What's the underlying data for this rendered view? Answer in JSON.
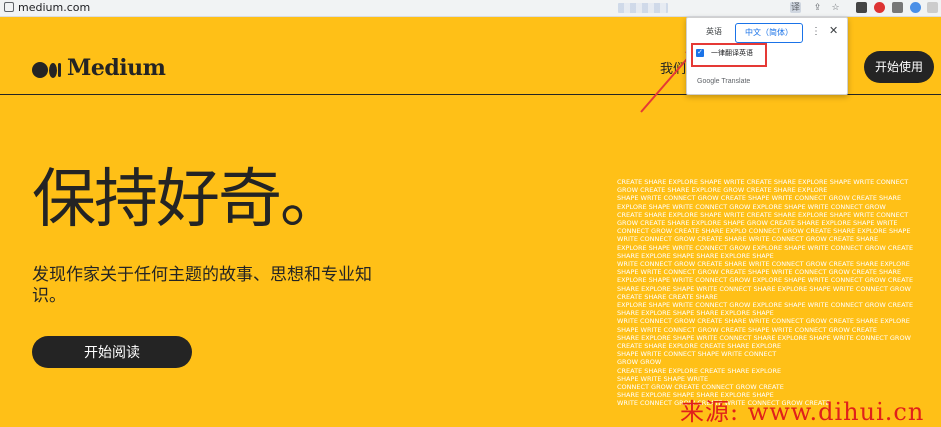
{
  "browser": {
    "url": "medium.com"
  },
  "header": {
    "logo_text": "Medium",
    "nav_partial": "我们",
    "start_button": "开始使用"
  },
  "hero": {
    "title": "保持好奇。",
    "subtitle": "发现作家关于任何主题的故事、思想和专业知识。",
    "read_button": "开始阅读"
  },
  "translate_popup": {
    "tab_source": "英语",
    "tab_target": "中文（简体）",
    "always_translate": "一律翻译英语",
    "always_checked": true,
    "footer_brand": "Google",
    "footer_product": "Translate"
  },
  "word_art": [
    "CREATE SHARE EXPLORE SHAPE WRITE  CREATE SHARE EXPLORE SHAPE WRITE CONNECT",
    "GROW CREATE SHARE EXPLORE         GROW CREATE SHARE EXPLORE",
    "SHAPE WRITE CONNECT GROW CREATE   SHAPE WRITE CONNECT GROW CREATE SHARE",
    "EXPLORE SHAPE WRITE CONNECT GROW  EXPLORE SHAPE WRITE CONNECT GROW",
    "CREATE SHARE EXPLORE SHAPE WRITE  CREATE SHARE EXPLORE SHAPE WRITE CONNECT",
    "GROW CREATE SHARE EXPLORE SHAPE   GROW CREATE SHARE EXPLORE SHAPE WRITE",
    "CONNECT GROW CREATE SHARE EXPLO   CONNECT GROW CREATE SHARE EXPLORE SHAPE",
    "WRITE CONNECT GROW CREATE SHARE   WRITE CONNECT GROW CREATE SHARE",
    "EXPLORE SHAPE WRITE CONNECT GROW  EXPLORE SHAPE WRITE CONNECT GROW CREATE",
    "SHARE EXPLORE SHAPE               SHARE EXPLORE SHAPE",
    "WRITE CONNECT GROW CREATE SHARE   WRITE CONNECT GROW CREATE SHARE EXPLORE",
    "SHAPE WRITE CONNECT GROW CREATE   SHAPE WRITE CONNECT GROW CREATE SHARE",
    "EXPLORE SHAPE WRITE CONNECT GROW  EXPLORE SHAPE WRITE CONNECT GROW CREATE",
    "SHARE EXPLORE SHAPE WRITE CONNECT SHARE EXPLORE SHAPE WRITE CONNECT GROW",
    "CREATE SHARE                      CREATE SHARE",
    "EXPLORE SHAPE WRITE CONNECT GROW  EXPLORE SHAPE WRITE CONNECT GROW CREATE",
    "SHARE EXPLORE SHAPE               SHARE EXPLORE SHAPE",
    "WRITE CONNECT GROW CREATE SHARE   WRITE CONNECT GROW CREATE SHARE EXPLORE",
    "SHAPE WRITE CONNECT GROW CREATE   SHAPE WRITE CONNECT GROW CREATE",
    "SHARE EXPLORE SHAPE WRITE CONNECT SHARE EXPLORE SHAPE WRITE CONNECT GROW",
    "           CREATE SHARE EXPLORE            CREATE SHARE EXPLORE",
    "           SHAPE WRITE CONNECT             SHAPE WRITE CONNECT",
    "           GROW                            GROW",
    "           CREATE SHARE EXPLORE            CREATE SHARE EXPLORE",
    "           SHAPE WRITE                     SHAPE WRITE",
    "           CONNECT GROW CREATE             CONNECT GROW CREATE",
    "           SHARE EXPLORE SHAPE             SHARE EXPLORE SHAPE",
    "           WRITE CONNECT GROW CREATE       WRITE CONNECT GROW CREATE"
  ],
  "watermark": "来源: www.dihui.cn",
  "colors": {
    "background": "#ffc017",
    "dark": "#242424",
    "accent": "#1a73e8",
    "highlight": "#e53935"
  }
}
